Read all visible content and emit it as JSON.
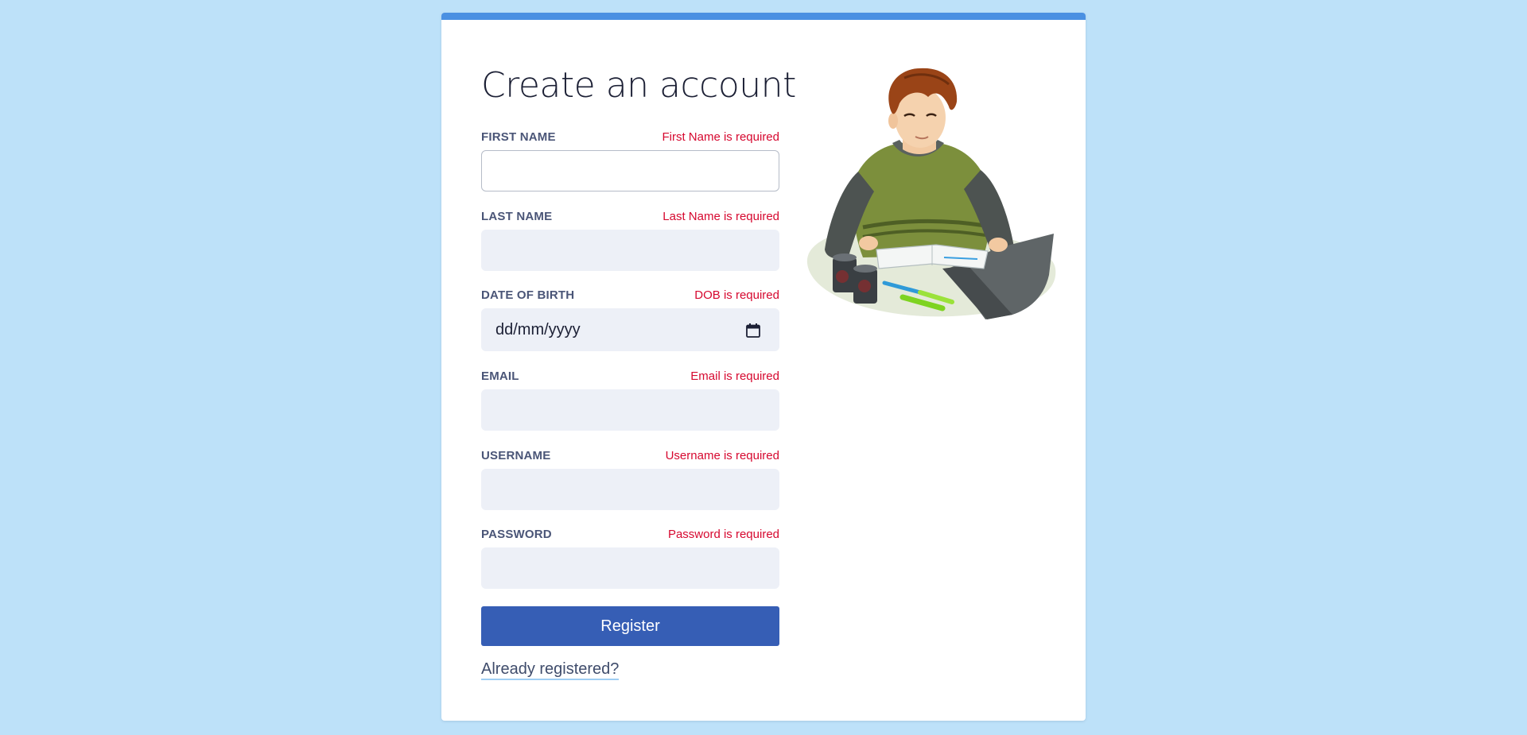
{
  "page": {
    "title": "Create an account"
  },
  "fields": {
    "first_name": {
      "label": "FIRST NAME",
      "error": "First Name is required",
      "value": ""
    },
    "last_name": {
      "label": "LAST NAME",
      "error": "Last Name is required",
      "value": ""
    },
    "dob": {
      "label": "DATE OF BIRTH",
      "error": "DOB is required",
      "placeholder": "dd/mm/yyyy"
    },
    "email": {
      "label": "EMAIL",
      "error": "Email is required",
      "value": ""
    },
    "username": {
      "label": "USERNAME",
      "error": "Username is required",
      "value": ""
    },
    "password": {
      "label": "PASSWORD",
      "error": "Password is required",
      "value": ""
    }
  },
  "actions": {
    "register_label": "Register",
    "login_link": "Already registered?"
  },
  "icons": {
    "calendar": "calendar-icon"
  },
  "colors": {
    "page_background": "#bde1f9",
    "card_accent": "#4a90e2",
    "primary_button": "#365eb5",
    "error_text": "#d6082f",
    "label_text": "#4a5577",
    "input_background": "#edf0f7"
  }
}
